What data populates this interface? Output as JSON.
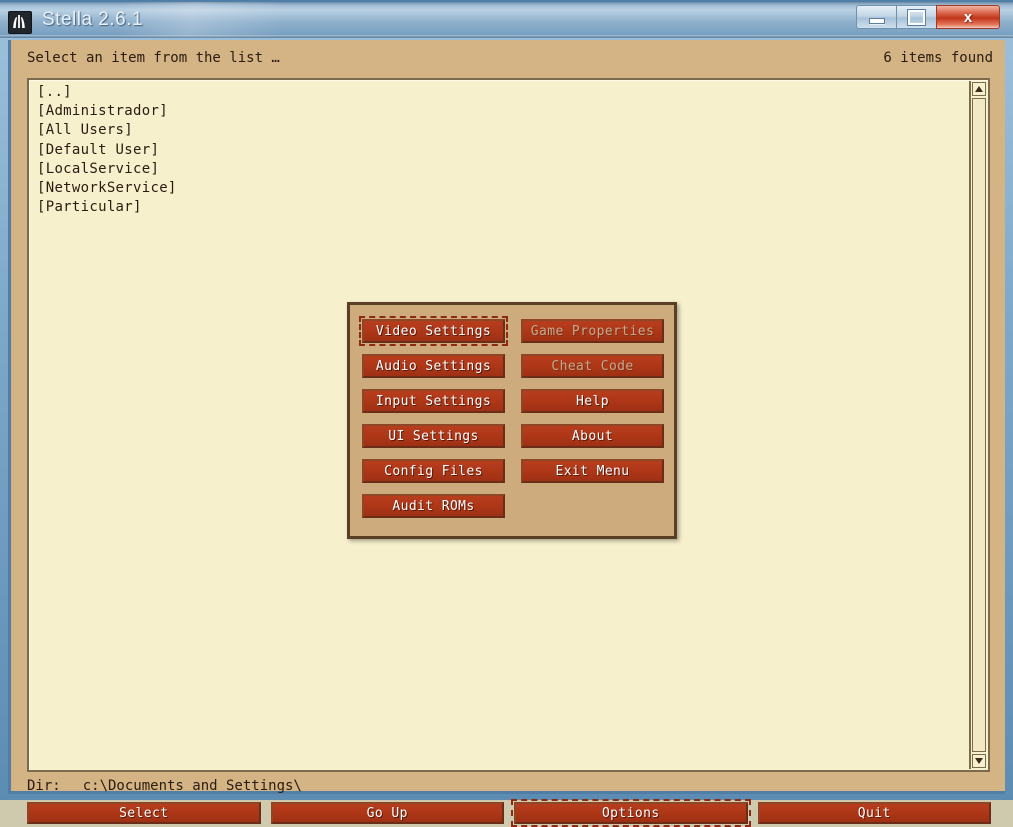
{
  "window": {
    "title": "Stella 2.6.1",
    "icon": "atari-fuji-icon",
    "caption_buttons": {
      "minimize": "minimize-icon",
      "maximize": "maximize-icon",
      "close": "x"
    }
  },
  "status": {
    "prompt": "Select an item from the list …",
    "items_found": "6 items found"
  },
  "file_list": {
    "items": [
      {
        "label": "[..]"
      },
      {
        "label": "[Administrador]"
      },
      {
        "label": "[All Users]"
      },
      {
        "label": "[Default User]"
      },
      {
        "label": "[LocalService]"
      },
      {
        "label": "[NetworkService]"
      },
      {
        "label": "[Particular]"
      }
    ],
    "scrollbar": {
      "up_arrow": "chevron-up-icon",
      "down_arrow": "chevron-down-icon"
    }
  },
  "options_dialog": {
    "left_column": [
      {
        "label": "Video Settings",
        "disabled": false,
        "focused": true
      },
      {
        "label": "Audio Settings",
        "disabled": false,
        "focused": false
      },
      {
        "label": "Input Settings",
        "disabled": false,
        "focused": false
      },
      {
        "label": "UI Settings",
        "disabled": false,
        "focused": false
      },
      {
        "label": "Config Files",
        "disabled": false,
        "focused": false
      },
      {
        "label": "Audit ROMs",
        "disabled": false,
        "focused": false
      }
    ],
    "right_column": [
      {
        "label": "Game Properties",
        "disabled": true,
        "focused": false
      },
      {
        "label": "Cheat Code",
        "disabled": true,
        "focused": false
      },
      {
        "label": "Help",
        "disabled": false,
        "focused": false
      },
      {
        "label": "About",
        "disabled": false,
        "focused": false
      },
      {
        "label": "Exit Menu",
        "disabled": false,
        "focused": false
      }
    ]
  },
  "directory": {
    "label": "Dir:",
    "path": "c:\\Documents and Settings\\"
  },
  "bottom_buttons": [
    {
      "label": "Select",
      "focused": false
    },
    {
      "label": "Go Up",
      "focused": false
    },
    {
      "label": "Options",
      "focused": true
    },
    {
      "label": "Quit",
      "focused": false
    }
  ],
  "colors": {
    "accent_red": "#ae3717",
    "surface_tan": "#d4b384",
    "dialog_tan": "#cdab7c",
    "list_cream": "#f7f0cd",
    "border_brown": "#5a3e26",
    "title_blue": "#7da8ca"
  }
}
